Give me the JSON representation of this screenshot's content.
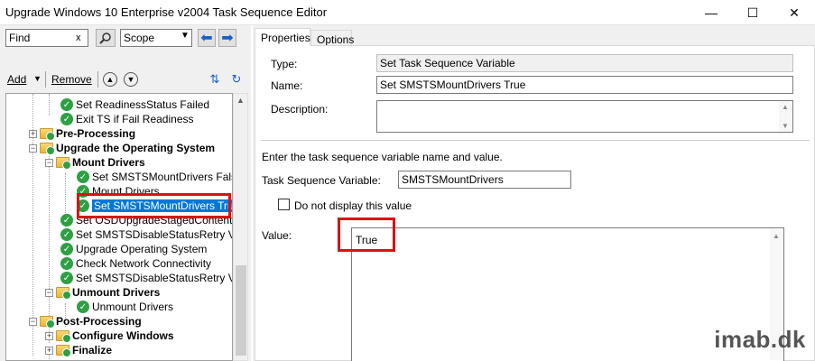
{
  "window": {
    "title": "Upgrade Windows 10 Enterprise v2004 Task Sequence Editor"
  },
  "find": {
    "value": "Find",
    "clear": "x",
    "scope": "Scope"
  },
  "toolbar": {
    "add_label": "Add",
    "remove_label": "Remove"
  },
  "tree": {
    "items": [
      {
        "label": "Set ReadinessStatus Failed"
      },
      {
        "label": "Exit TS if Fail Readiness"
      },
      {
        "label": "Pre-Processing"
      },
      {
        "label": "Upgrade the Operating System"
      },
      {
        "label": "Mount Drivers"
      },
      {
        "label": "Set SMSTSMountDrivers False"
      },
      {
        "label": "Mount Drivers"
      },
      {
        "label": "Set SMSTSMountDrivers True"
      },
      {
        "label": "Set OSDUpgradeStagedContent"
      },
      {
        "label": "Set SMSTSDisableStatusRetry Varia"
      },
      {
        "label": "Upgrade Operating System"
      },
      {
        "label": "Check Network Connectivity"
      },
      {
        "label": "Set SMSTSDisableStatusRetry Varia"
      },
      {
        "label": "Unmount Drivers"
      },
      {
        "label": "Unmount Drivers"
      },
      {
        "label": "Post-Processing"
      },
      {
        "label": "Configure Windows"
      },
      {
        "label": "Finalize"
      }
    ]
  },
  "tabs": [
    {
      "label": "Properties"
    },
    {
      "label": "Options"
    }
  ],
  "properties": {
    "type_label": "Type:",
    "type_value": "Set Task Sequence Variable",
    "name_label": "Name:",
    "name_value": "Set SMSTSMountDrivers True",
    "description_label": "Description:",
    "description_value": "",
    "instructions": "Enter the task sequence variable name and value.",
    "variable_label": "Task Sequence Variable:",
    "variable_value": "SMSTSMountDrivers",
    "donotdisplay_label": "Do not display this value",
    "value_label": "Value:",
    "value_value": "True"
  },
  "watermark": "imab.dk",
  "colors": {
    "selection": "#0078d7",
    "highlight": "#dd1111",
    "success": "#2ea043"
  }
}
